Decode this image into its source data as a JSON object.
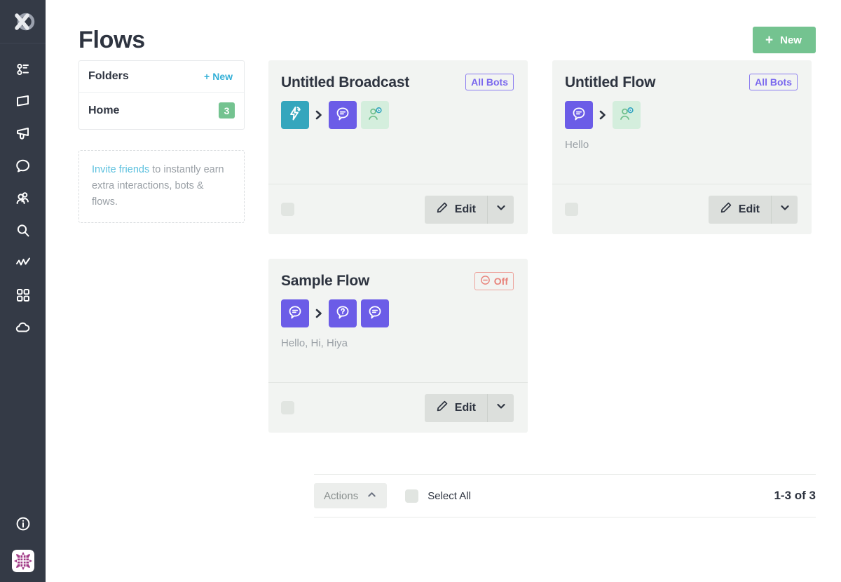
{
  "colors": {
    "rail_bg": "#343a46",
    "accent_green": "#74c390",
    "accent_purple": "#6b5ce7",
    "accent_teal": "#35a6bd",
    "accent_red": "#e8837b",
    "link_blue": "#35b0d7",
    "card_bg": "#f2f4f2"
  },
  "rail": {
    "logo_name": "manychat-logo",
    "items": [
      {
        "icon": "automation-icon",
        "name": "sidebar-item-automation"
      },
      {
        "icon": "flag-icon",
        "name": "sidebar-item-flows"
      },
      {
        "icon": "megaphone-icon",
        "name": "sidebar-item-broadcasting"
      },
      {
        "icon": "chat-bubble-icon",
        "name": "sidebar-item-live-chat"
      },
      {
        "icon": "audience-icon",
        "name": "sidebar-item-audience"
      },
      {
        "icon": "search-icon",
        "name": "sidebar-item-search"
      },
      {
        "icon": "analytics-icon",
        "name": "sidebar-item-growth-tools"
      },
      {
        "icon": "grid-apps-icon",
        "name": "sidebar-item-apps"
      },
      {
        "icon": "cloud-icon",
        "name": "sidebar-item-cloud"
      }
    ],
    "bottom": [
      {
        "icon": "info-icon",
        "name": "sidebar-item-info"
      }
    ],
    "avatar_name": "avatar"
  },
  "header": {
    "title": "Flows",
    "new_button": {
      "label": "New",
      "plus": "+"
    }
  },
  "folders": {
    "title": "Folders",
    "new_label": "New",
    "new_plus": "+",
    "rows": [
      {
        "name": "Home",
        "count": "3"
      }
    ]
  },
  "invite": {
    "link": "Invite friends",
    "text": " to instantly earn extra interactions, bots & flows."
  },
  "cards": [
    {
      "title": "Untitled Broadcast",
      "badge": {
        "label": "All Bots",
        "type": "bots",
        "icon": null
      },
      "tiles": [
        {
          "style": "teal",
          "icon": "broadcast-lightning-icon"
        },
        {
          "sep": true
        },
        {
          "style": "purple",
          "icon": "message-bubble-icon"
        },
        {
          "style": "green",
          "icon": "user-action-icon"
        }
      ],
      "subtitle": "",
      "edit_label": "Edit"
    },
    {
      "title": "Untitled Flow",
      "badge": {
        "label": "All Bots",
        "type": "bots",
        "icon": null
      },
      "tiles": [
        {
          "style": "purple",
          "icon": "message-bubble-icon"
        },
        {
          "sep": true
        },
        {
          "style": "green",
          "icon": "user-action-icon"
        }
      ],
      "subtitle": "Hello",
      "edit_label": "Edit"
    },
    {
      "title": "Sample Flow",
      "badge": {
        "label": "Off",
        "type": "off",
        "icon": "minus-circle-icon"
      },
      "tiles": [
        {
          "style": "purple",
          "icon": "message-bubble-icon"
        },
        {
          "sep": true
        },
        {
          "style": "purple",
          "icon": "question-bubble-icon"
        },
        {
          "style": "purple",
          "icon": "message-bubble-icon"
        }
      ],
      "subtitle": "Hello, Hi, Hiya",
      "edit_label": "Edit"
    }
  ],
  "footer": {
    "actions_label": "Actions",
    "select_all_label": "Select All",
    "count": "1-3 of 3"
  }
}
